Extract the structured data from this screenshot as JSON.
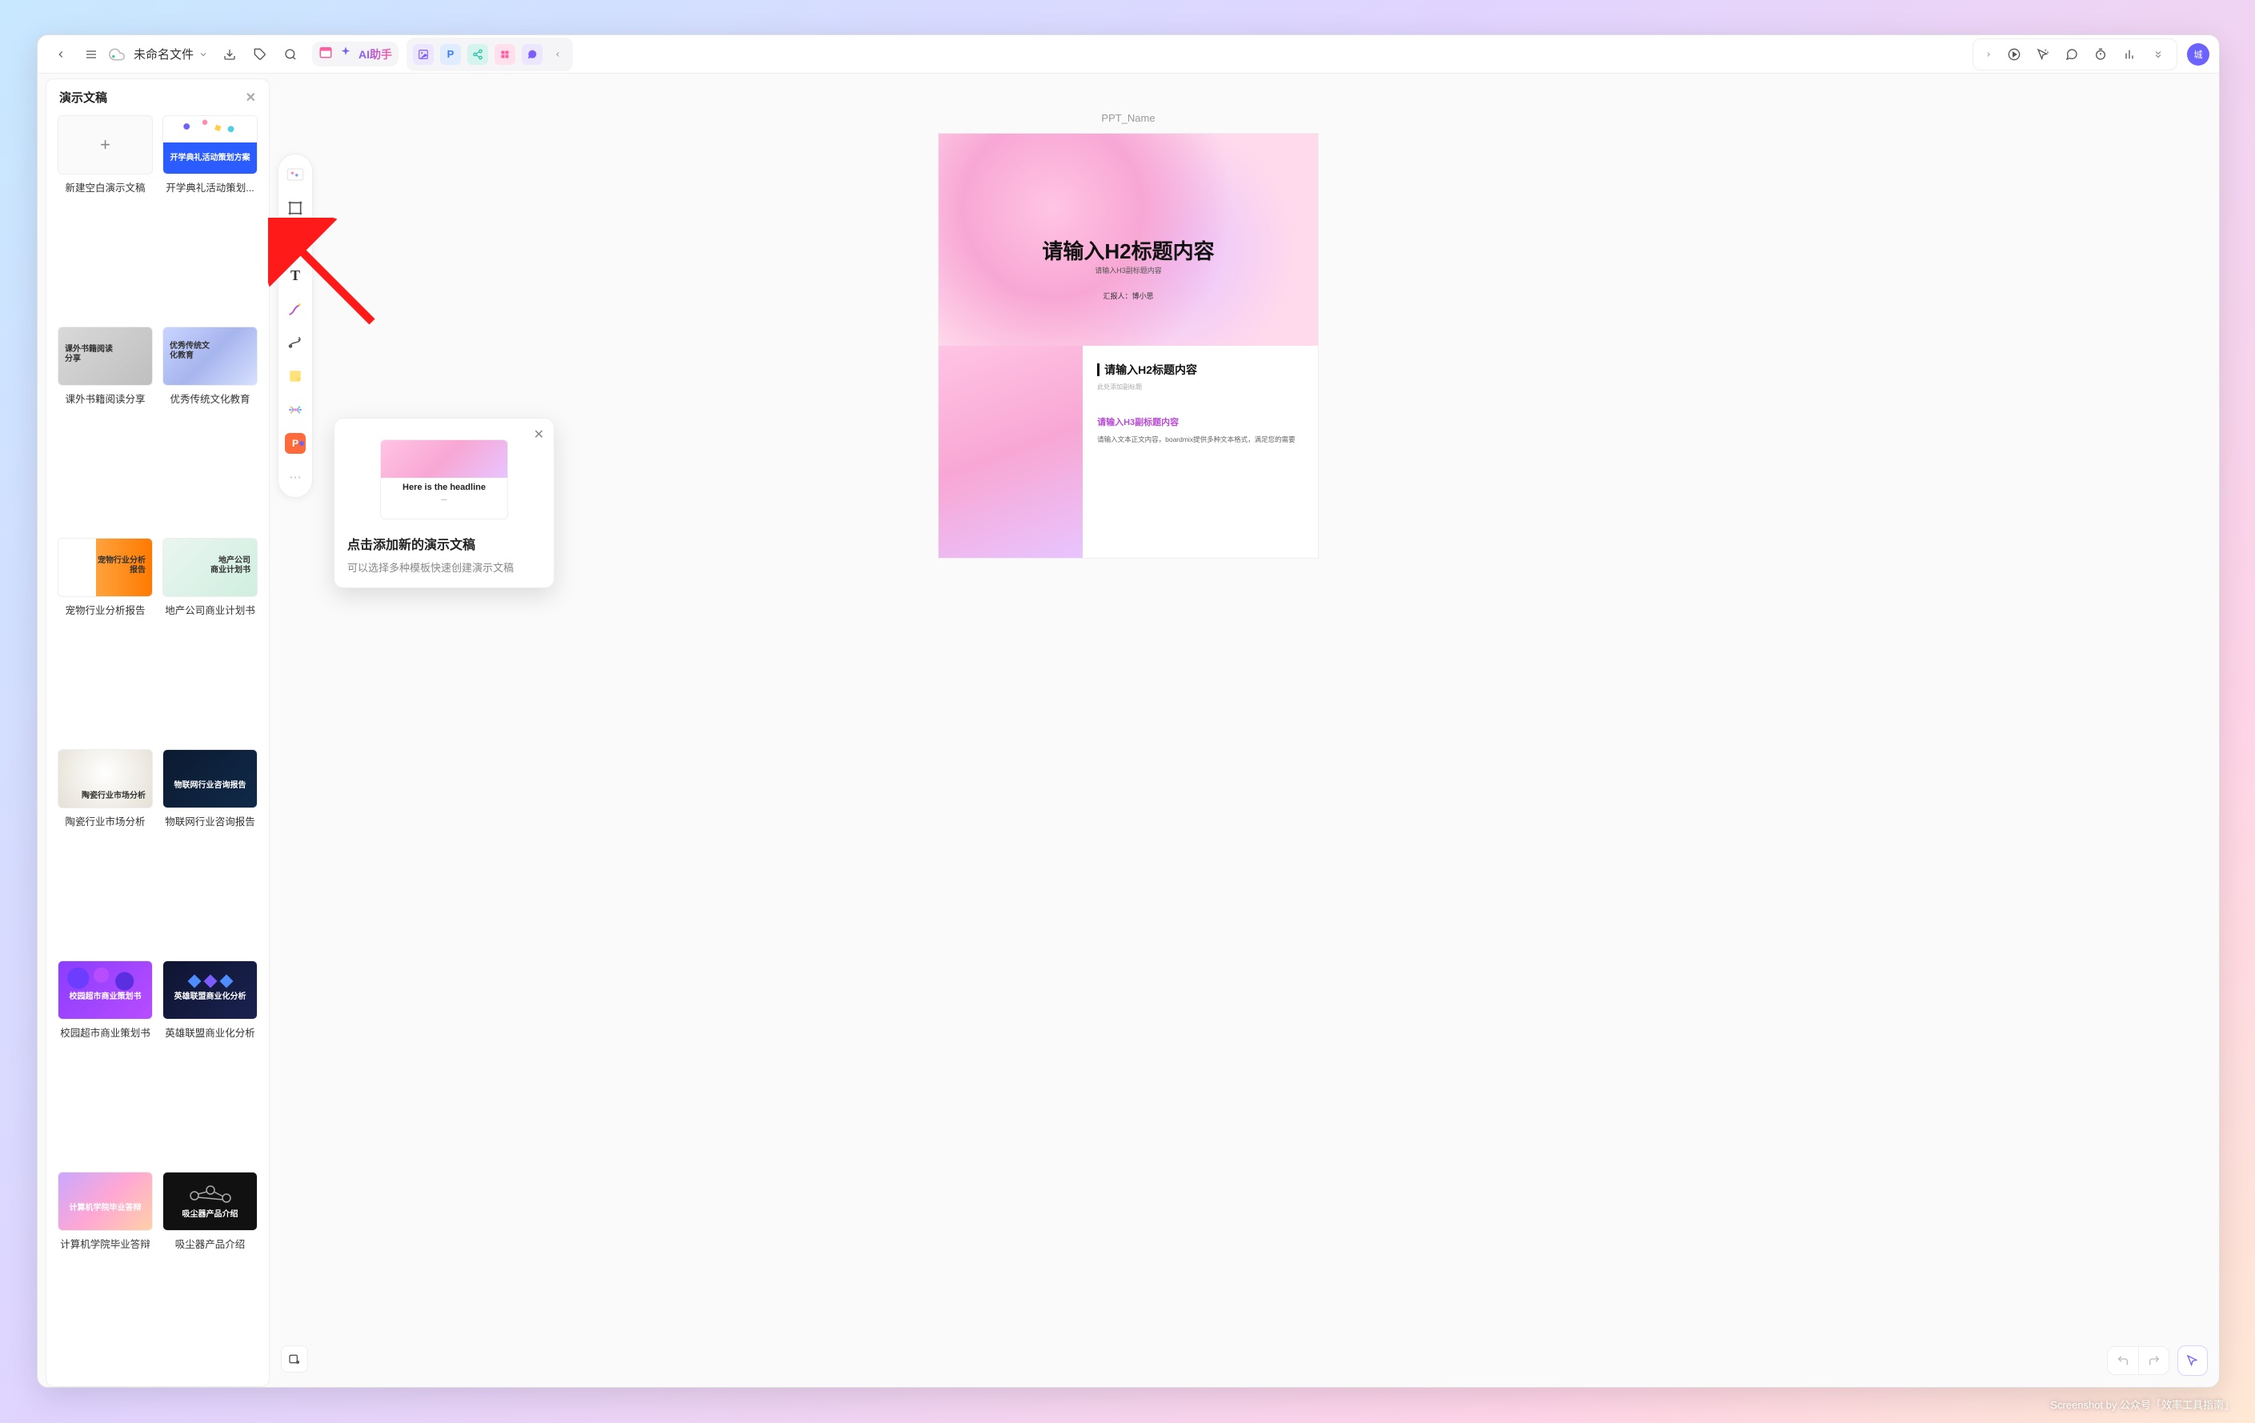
{
  "toolbar": {
    "filename": "未命名文件",
    "ai_label": "AI助手",
    "badge_p": "P"
  },
  "sidepanel": {
    "title": "演示文稿",
    "templates": [
      {
        "label": "新建空白演示文稿",
        "thumb_caption": "",
        "thumb_style": "plus"
      },
      {
        "label": "开学典礼活动策划...",
        "thumb_caption": "开学典礼活动策划方案",
        "thumb_style": "blue-party"
      },
      {
        "label": "课外书籍阅读分享",
        "thumb_caption": "课外书籍阅读\n分享",
        "thumb_style": "book-grey"
      },
      {
        "label": "优秀传统文化教育",
        "thumb_caption": "优秀传统文\n化教育",
        "thumb_style": "marble"
      },
      {
        "label": "宠物行业分析报告",
        "thumb_caption": "宠物行业分析\n报告",
        "thumb_style": "orange-split"
      },
      {
        "label": "地产公司商业计划书",
        "thumb_caption": "地产公司\n商业计划书",
        "thumb_style": "mint"
      },
      {
        "label": "陶瓷行业市场分析",
        "thumb_caption": "陶瓷行业市场分析",
        "thumb_style": "ceramic"
      },
      {
        "label": "物联网行业咨询报告",
        "thumb_caption": "物联网行业咨询报告",
        "thumb_style": "iot-dark"
      },
      {
        "label": "校园超市商业策划书",
        "thumb_caption": "校园超市商业策划书",
        "thumb_style": "campus-purple"
      },
      {
        "label": "英雄联盟商业化分析",
        "thumb_caption": "英雄联盟商业化分析",
        "thumb_style": "lol-dark"
      },
      {
        "label": "计算机学院毕业答辩",
        "thumb_caption": "计算机学院毕业答辩",
        "thumb_style": "gradient-pink"
      },
      {
        "label": "吸尘器产品介绍",
        "thumb_caption": "吸尘器产品介绍",
        "thumb_style": "vacuum-dark"
      }
    ]
  },
  "vertical_toolbar": {
    "ppt_badge": "P"
  },
  "popover": {
    "preview_headline": "Here is the headline",
    "preview_sub": "—",
    "title": "点击添加新的演示文稿",
    "desc": "可以选择多种模板快速创建演示文稿"
  },
  "canvas": {
    "name": "PPT_Name",
    "slide1": {
      "title": "请输入H2标题内容",
      "sub1": "请输入H3副标题内容",
      "presenter": "汇报人：博小思"
    },
    "slide2": {
      "h2": "请输入H2标题内容",
      "small": "此处添加副标题",
      "h3": "请输入H3副标题内容",
      "body": "请输入文本正文内容，boardmix提供多种文本格式，满足您的需要"
    }
  },
  "avatar_text": "城",
  "watermark": "Screenshot by 公众号「效率工具指南」"
}
